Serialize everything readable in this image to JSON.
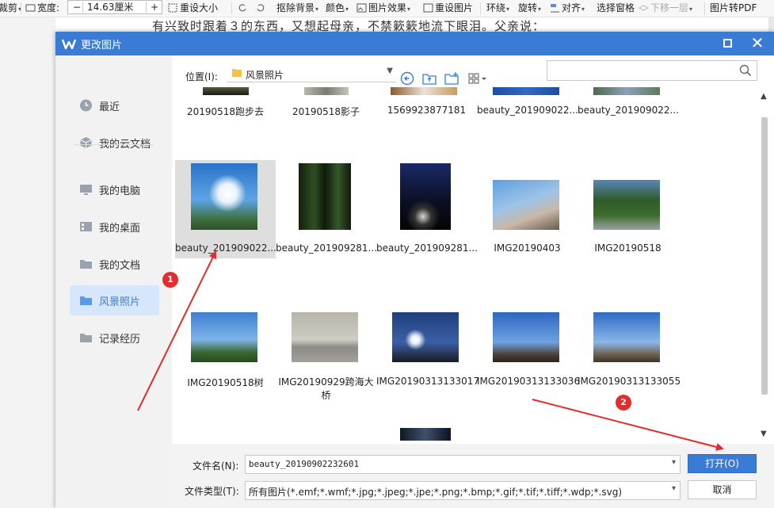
{
  "toolbar": {
    "crop_label": "裁剪",
    "width_label": "宽度:",
    "width_value": "14.63厘米",
    "minus": "−",
    "plus": "+",
    "reset_size": "重设大小",
    "remove_bg": "抠除背景",
    "color": "颜色",
    "picture_effects": "图片效果",
    "reset_picture": "重设图片",
    "wrap": "环绕",
    "rotate": "旋转",
    "align": "对齐",
    "selection_pane": "选择窗格",
    "send_backward": "下移一层",
    "to_pdf": "图片转PDF"
  },
  "document": {
    "text": "有兴致时跟着３的东西，又想起母亲，不禁簌簌地流下眼泪。父亲说："
  },
  "dialog": {
    "title": "更改图片",
    "sidebar": [
      {
        "label": "最近",
        "icon": "clock-icon"
      },
      {
        "label": "我的云文档",
        "icon": "cloud-box-icon"
      },
      {
        "label": "我的电脑",
        "icon": "monitor-icon"
      },
      {
        "label": "我的桌面",
        "icon": "desktop-icon"
      },
      {
        "label": "我的文档",
        "icon": "folder-icon"
      },
      {
        "label": "风景照片",
        "icon": "folder-icon"
      },
      {
        "label": "记录经历",
        "icon": "folder-icon"
      }
    ],
    "active_folder": "风景照片",
    "location_label": "位置(I):",
    "location_value": "风景照片",
    "search_placeholder": "",
    "files_row0": [
      "20190518跑步去",
      "20190518影子",
      "1569923877181",
      "beauty_201909022...",
      "beauty_201909022..."
    ],
    "files": [
      "beauty_201909022...",
      "beauty_201909281...",
      "beauty_201909281...",
      "IMG20190403",
      "IMG20190518",
      "IMG20190518树",
      "IMG20190929跨海大桥",
      "IMG20190313133017",
      "IMG20190313133036",
      "IMG20190313133055"
    ],
    "filename_label": "文件名(N):",
    "filename_value": "beauty_20190902232601",
    "filetype_label": "文件类型(T):",
    "filetype_value": "所有图片(*.emf;*.wmf;*.jpg;*.jpeg;*.jpe;*.png;*.bmp;*.gif;*.tif;*.tiff;*.wdp;*.svg)",
    "open_button": "打开(O)",
    "cancel_button": "取消"
  },
  "annotations": {
    "badge1": "1",
    "badge2": "2",
    "color": "#e52b2b"
  },
  "colors": {
    "accent": "#3a7bd5",
    "selected_tile": "#dedede",
    "sidebar_active": "#d6e6fb"
  }
}
